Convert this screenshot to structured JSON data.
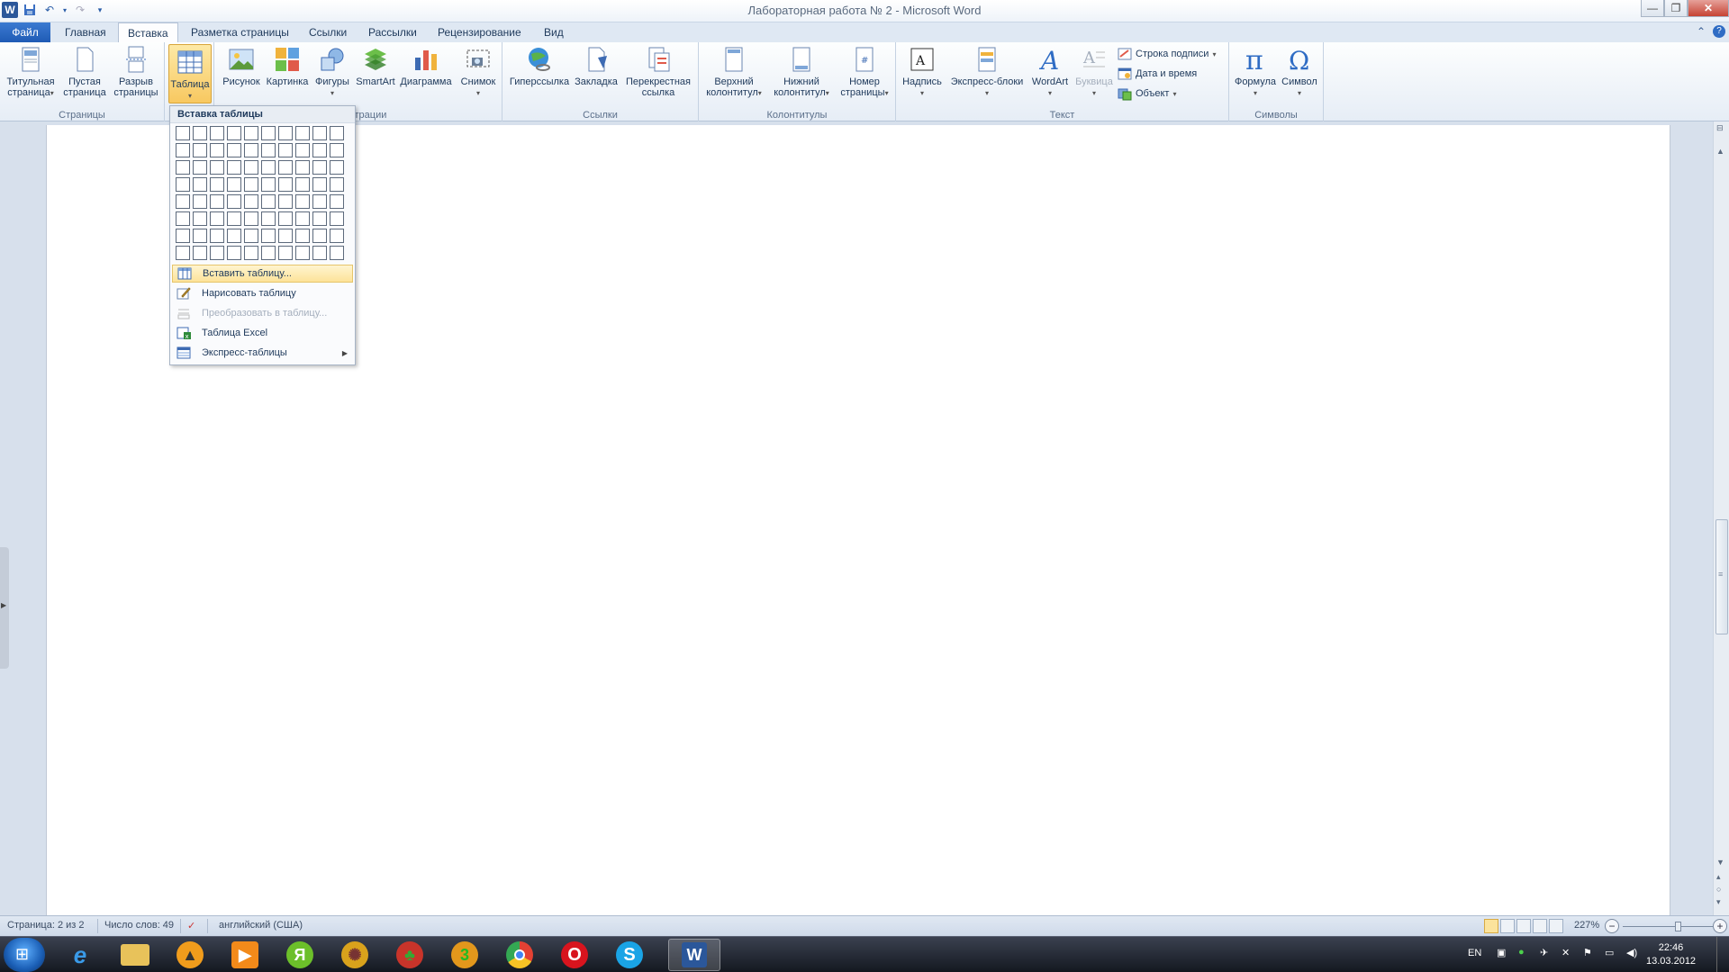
{
  "window": {
    "title": "Лабораторная работа № 2  -  Microsoft Word"
  },
  "qat": {
    "logo": "W",
    "save_icon": "floppy-icon",
    "undo_icon": "undo-icon",
    "redo_icon": "redo-icon"
  },
  "tabs": [
    {
      "label": "Файл"
    },
    {
      "label": "Главная"
    },
    {
      "label": "Вставка"
    },
    {
      "label": "Разметка страницы"
    },
    {
      "label": "Ссылки"
    },
    {
      "label": "Рассылки"
    },
    {
      "label": "Рецензирование"
    },
    {
      "label": "Вид"
    }
  ],
  "ribbon": {
    "pages": {
      "label": "Страницы",
      "btn_cover": "Титульная\nстраница",
      "btn_blank": "Пустая\nстраница",
      "btn_break": "Разрыв\nстраницы"
    },
    "tables": {
      "btn_table": "Таблица"
    },
    "illustrations": {
      "label": "Иллюстрации",
      "label_visible": "страции",
      "btn_picture": "Рисунок",
      "btn_clipart": "Картинка",
      "btn_shapes": "Фигуры",
      "btn_smartart": "SmartArt",
      "btn_chart": "Диаграмма",
      "btn_screenshot": "Снимок"
    },
    "links": {
      "label": "Ссылки",
      "btn_hyperlink": "Гиперссылка",
      "btn_bookmark": "Закладка",
      "btn_crossref": "Перекрестная\nссылка"
    },
    "headers": {
      "label": "Колонтитулы",
      "btn_header": "Верхний\nколонтитул",
      "btn_footer": "Нижний\nколонтитул",
      "btn_pagenum": "Номер\nстраницы"
    },
    "text": {
      "label": "Текст",
      "btn_textbox": "Надпись",
      "btn_quickparts": "Экспресс-блоки",
      "btn_wordart": "WordArt",
      "btn_dropcap": "Буквица",
      "btn_sigline": "Строка подписи",
      "btn_datetime": "Дата и время",
      "btn_object": "Объект"
    },
    "symbols": {
      "label": "Символы",
      "btn_equation": "Формула",
      "btn_symbol": "Символ"
    }
  },
  "table_dropdown": {
    "header": "Вставка таблицы",
    "grid": {
      "cols": 10,
      "rows": 8
    },
    "items": [
      {
        "label": "Вставить таблицу...",
        "state": "hover"
      },
      {
        "label": "Нарисовать таблицу",
        "state": "normal"
      },
      {
        "label": "Преобразовать в таблицу...",
        "state": "disabled"
      },
      {
        "label": "Таблица Excel",
        "state": "normal"
      },
      {
        "label": "Экспресс-таблицы",
        "state": "normal",
        "submenu": true
      }
    ]
  },
  "statusbar": {
    "page": "Страница: 2 из 2",
    "words": "Число слов: 49",
    "language": "английский (США)",
    "zoom": "227%"
  },
  "taskbar": {
    "apps": [
      "internet-explorer-icon",
      "folder-icon",
      "aimp-icon",
      "media-player-icon",
      "yandex-icon",
      "game-icon",
      "winamp-icon",
      "zone-icon",
      "chrome-icon",
      "opera-icon",
      "skype-icon",
      "word-icon"
    ],
    "lang": "EN",
    "time": "22:46",
    "date": "13.03.2012"
  }
}
